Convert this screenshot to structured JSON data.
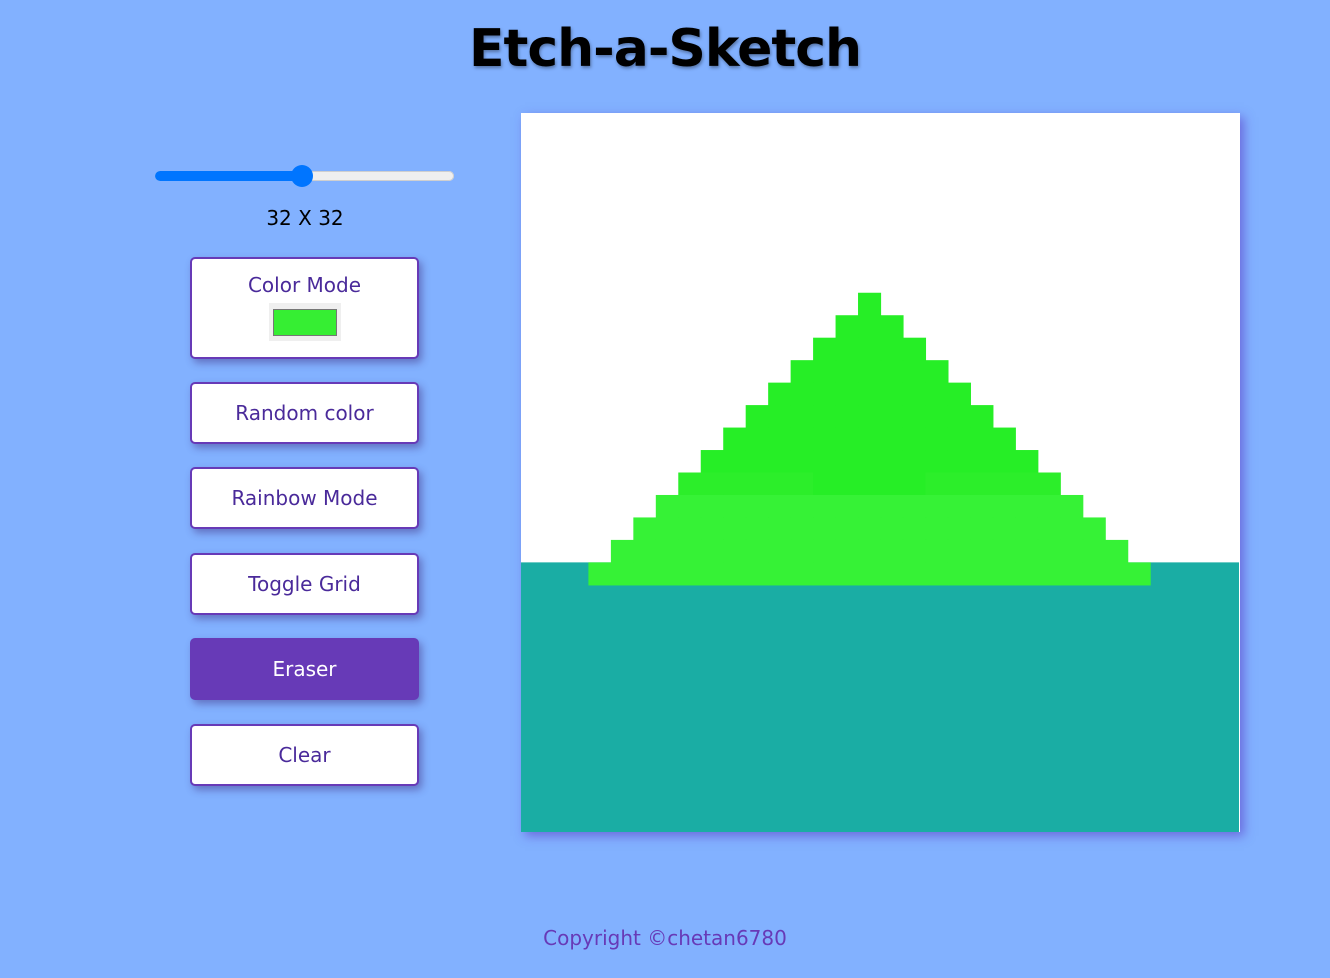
{
  "app": {
    "title": "Etch-a-Sketch"
  },
  "controls": {
    "grid_size_slider": {
      "value": 32,
      "fill_fraction": 0.49
    },
    "grid_size_label": "32 X 32",
    "color_mode": {
      "label": "Color Mode",
      "selected_color": "#36ee33"
    },
    "buttons": {
      "random_color": "Random color",
      "rainbow_mode": "Rainbow Mode",
      "toggle_grid": "Toggle Grid",
      "eraser": "Eraser",
      "clear": "Clear"
    },
    "active_button": "eraser"
  },
  "board": {
    "grid_cells": 32,
    "colors": {
      "background": "#ffffff",
      "water": "#1aada4",
      "green_dark": "#26ee26",
      "green_mid": "#2cee2a",
      "green_light": "#36f236"
    },
    "water_start_row": 20
  },
  "footer": {
    "copyright": "Copyright ©chetan6780"
  },
  "colors": {
    "page_background": "#82b1ff",
    "accent": "#673ab7",
    "slider": "#0075ff"
  }
}
